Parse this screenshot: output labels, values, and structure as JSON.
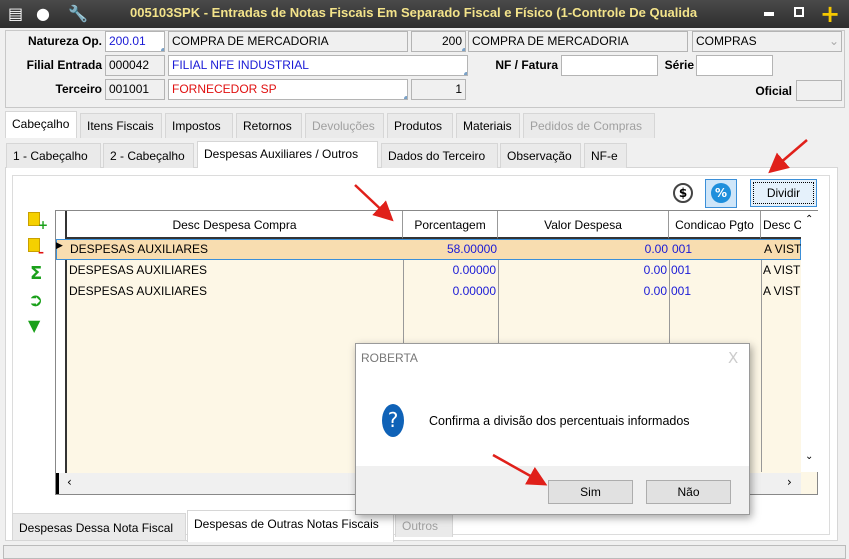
{
  "window": {
    "title": "005103SPK - Entradas de Notas Fiscais Em Separado Fiscal e Físico (1-Controle De Qualida"
  },
  "form": {
    "natureza_label": "Natureza Op.",
    "natureza_code": "200.01",
    "natureza_desc": "COMPRA DE MERCADORIA",
    "natureza_num": "200",
    "natureza_desc2": "COMPRA DE MERCADORIA",
    "tipo": "COMPRAS",
    "filial_label": "Filial Entrada",
    "filial_code": "000042",
    "filial_desc": "FILIAL NFE INDUSTRIAL",
    "nf_label": "NF / Fatura",
    "nf_value": "",
    "serie_label": "Série",
    "serie_value": "",
    "terceiro_label": "Terceiro",
    "terceiro_code": "001001",
    "terceiro_desc": "FORNECEDOR SP",
    "terceiro_num": "1",
    "oficial_label": "Oficial",
    "oficial_value": ""
  },
  "tabs": [
    "Cabeçalho",
    "Itens Fiscais",
    "Impostos",
    "Retornos",
    "Devoluções",
    "Produtos",
    "Materiais",
    "Pedidos de Compras"
  ],
  "subtabs": [
    "1 - Cabeçalho",
    "2 - Cabeçalho",
    "Despesas Auxiliares / Outros",
    "Dados do Terceiro",
    "Observação",
    "NF-e"
  ],
  "toolbar": {
    "dividir": "Dividir",
    "dollar": "$",
    "percent": "%"
  },
  "grid": {
    "columns": [
      "Desc Despesa Compra",
      "Porcentagem",
      "Valor Despesa",
      "Condicao Pgto",
      "Desc C"
    ],
    "rows": [
      [
        "DESPESAS AUXILIARES",
        "58.00000",
        "0.00",
        "001",
        "A VIST"
      ],
      [
        "DESPESAS AUXILIARES",
        "0.00000",
        "0.00",
        "001",
        "A VIST"
      ],
      [
        "DESPESAS AUXILIARES",
        "0.00000",
        "0.00",
        "001",
        "A VIST"
      ]
    ]
  },
  "bottom_tabs": [
    "Despesas Dessa Nota Fiscal",
    "Despesas de Outras Notas Fiscais",
    "Outros"
  ],
  "dialog": {
    "title": "ROBERTA",
    "message": "Confirma a divisão dos percentuais informados",
    "yes": "Sim",
    "no": "Não",
    "close": "X"
  },
  "colors": {
    "accent_arrow": "#e0201a",
    "title_text": "#f3e38a",
    "selected_row": "#f8ddb0"
  }
}
